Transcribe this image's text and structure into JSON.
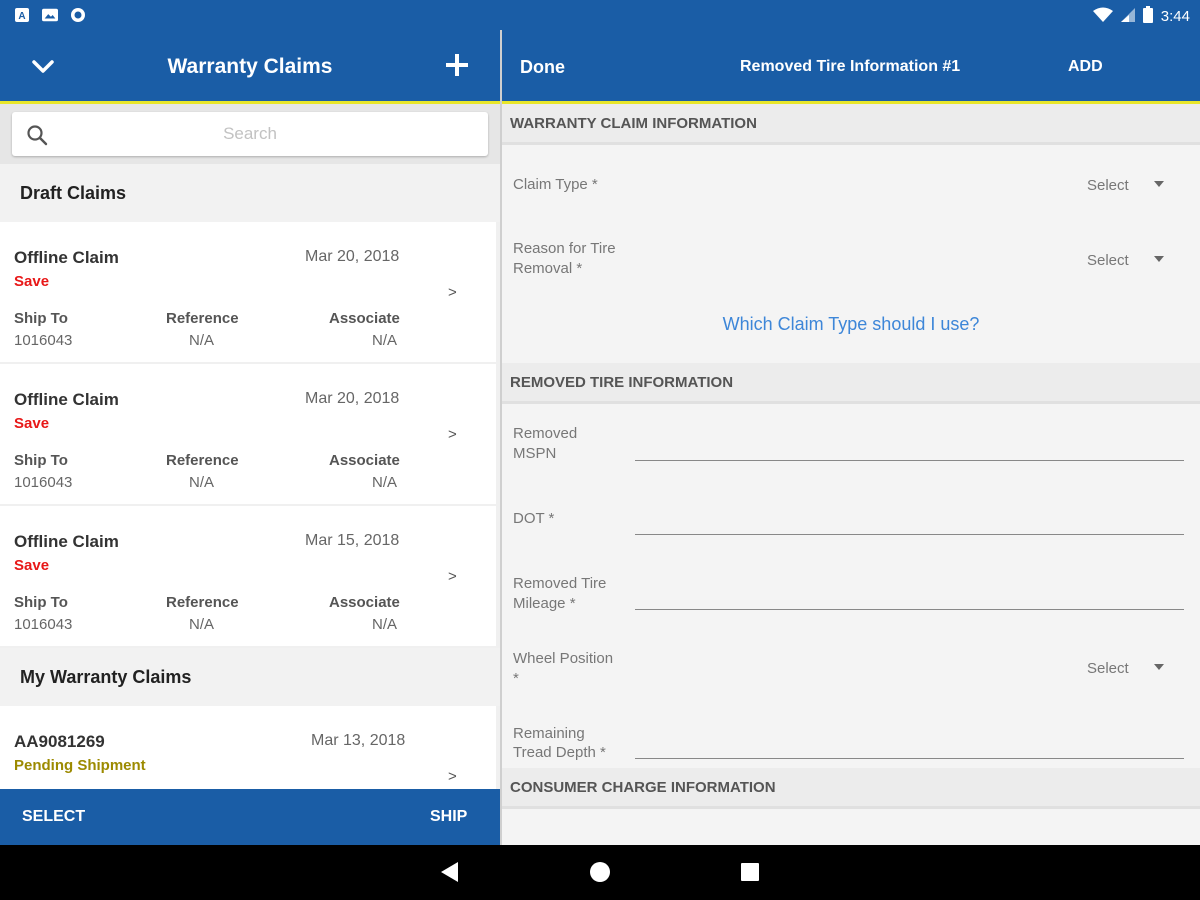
{
  "status_bar": {
    "time": "3:44",
    "left_icons": [
      "a-notification-icon",
      "photo-notification-icon",
      "circle-notification-icon"
    ],
    "right_icons": [
      "wifi-icon",
      "signal-icon",
      "battery-icon"
    ]
  },
  "left_panel": {
    "title": "Warranty Claims",
    "search_placeholder": "Search",
    "draft_section": "Draft Claims",
    "claims_section": "My Warranty Claims",
    "columns": {
      "ship_to": "Ship To",
      "reference": "Reference",
      "associate": "Associate"
    },
    "draft_claims": [
      {
        "name": "Offline Claim",
        "date": "Mar 20, 2018",
        "status": "Save",
        "ship_to": "1016043",
        "reference": "N/A",
        "associate": "N/A"
      },
      {
        "name": "Offline Claim",
        "date": "Mar 20, 2018",
        "status": "Save",
        "ship_to": "1016043",
        "reference": "N/A",
        "associate": "N/A"
      },
      {
        "name": "Offline Claim",
        "date": "Mar 15, 2018",
        "status": "Save",
        "ship_to": "1016043",
        "reference": "N/A",
        "associate": "N/A"
      }
    ],
    "my_claims": [
      {
        "name": "AA9081269",
        "date": "Mar 13, 2018",
        "status": "Pending Shipment"
      }
    ],
    "footer": {
      "select": "SELECT",
      "ship": "SHIP"
    }
  },
  "right_panel": {
    "done": "Done",
    "title": "Removed Tire Information #1",
    "add": "ADD",
    "section_warranty": "WARRANTY CLAIM INFORMATION",
    "claim_type_label": "Claim Type *",
    "reason_label_1": "Reason for Tire",
    "reason_label_2": "Removal *",
    "select_text": "Select",
    "help_link": "Which Claim Type should I use?",
    "section_removed": "REMOVED TIRE INFORMATION",
    "mspn_label_1": "Removed",
    "mspn_label_2": "MSPN",
    "dot_label": "DOT *",
    "mileage_label_1": "Removed Tire",
    "mileage_label_2": "Mileage *",
    "wheel_label_1": "Wheel Position",
    "wheel_label_2": "*",
    "tread_label_1": "Remaining",
    "tread_label_2": "Tread Depth *",
    "section_consumer": "CONSUMER CHARGE INFORMATION"
  },
  "colors": {
    "primary_blue": "#1a5da6",
    "accent_yellow": "#e8e62a",
    "save_red": "#e81818",
    "pending_olive": "#9c8a00",
    "link_blue": "#3d86d8"
  }
}
